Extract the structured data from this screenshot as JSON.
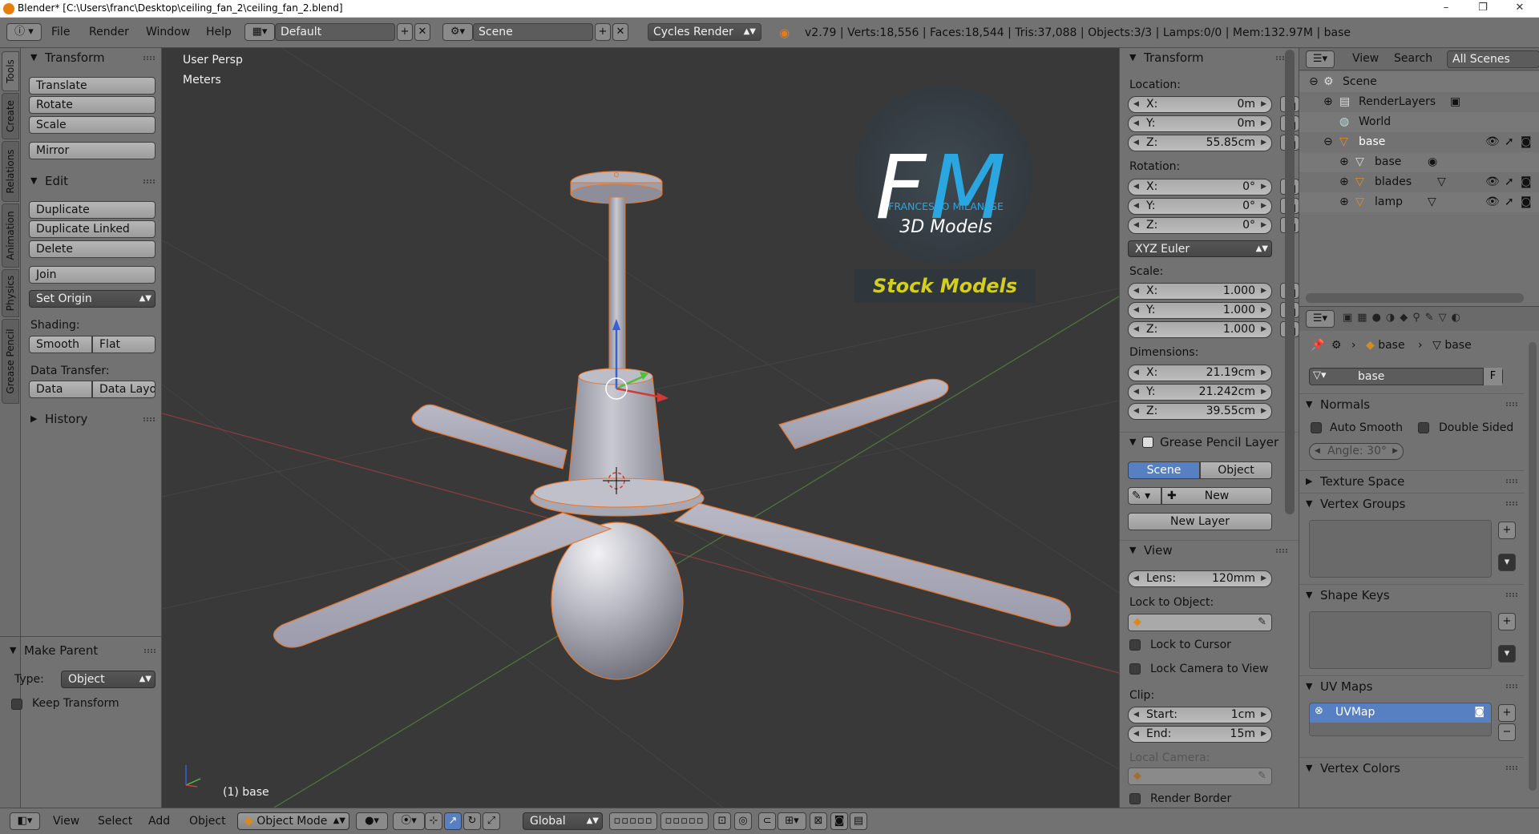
{
  "titlebar": {
    "title": "Blender* [C:\\Users\\franc\\Desktop\\ceiling_fan_2\\ceiling_fan_2.blend]",
    "minimize": "–",
    "maximize": "❐",
    "close": "✕"
  },
  "header": {
    "menus": [
      "File",
      "Render",
      "Window",
      "Help"
    ],
    "screen_layout": "Default",
    "scene": "Scene",
    "render_engine": "Cycles Render",
    "stats": "v2.79 | Verts:18,556 | Faces:18,544 | Tris:37,088 | Objects:3/3 | Lamps:0/0 | Mem:132.97M | base"
  },
  "tabs": [
    "Tools",
    "Create",
    "Relations",
    "Animation",
    "Physics",
    "Grease Pencil"
  ],
  "toolshelf": {
    "transform": {
      "title": "Transform",
      "buttons": [
        "Translate",
        "Rotate",
        "Scale",
        "Mirror"
      ]
    },
    "edit": {
      "title": "Edit",
      "buttons": [
        "Duplicate",
        "Duplicate Linked",
        "Delete",
        "Join"
      ],
      "set_origin": "Set Origin",
      "shading_label": "Shading:",
      "smooth": "Smooth",
      "flat": "Flat",
      "data_transfer_label": "Data Transfer:",
      "data": "Data",
      "data_layout": "Data Layo"
    },
    "history": "History",
    "make_parent": {
      "title": "Make Parent",
      "type_label": "Type:",
      "type_value": "Object",
      "keep_transform": "Keep Transform"
    }
  },
  "viewport": {
    "view_name": "User Persp",
    "units": "Meters",
    "selected": "(1) base",
    "watermark": {
      "letter_f": "F",
      "letter_m": "M",
      "line1": "FRANCESCO MILANESE",
      "line2": "3D Models",
      "banner": "Stock Models"
    }
  },
  "npanel": {
    "transform_title": "Transform",
    "location_label": "Location:",
    "location": [
      {
        "axis": "X:",
        "value": "0m"
      },
      {
        "axis": "Y:",
        "value": "0m"
      },
      {
        "axis": "Z:",
        "value": "55.85cm"
      }
    ],
    "rotation_label": "Rotation:",
    "rotation": [
      {
        "axis": "X:",
        "value": "0°"
      },
      {
        "axis": "Y:",
        "value": "0°"
      },
      {
        "axis": "Z:",
        "value": "0°"
      }
    ],
    "rotation_mode": "XYZ Euler",
    "scale_label": "Scale:",
    "scale": [
      {
        "axis": "X:",
        "value": "1.000"
      },
      {
        "axis": "Y:",
        "value": "1.000"
      },
      {
        "axis": "Z:",
        "value": "1.000"
      }
    ],
    "dimensions_label": "Dimensions:",
    "dimensions": [
      {
        "axis": "X:",
        "value": "21.19cm"
      },
      {
        "axis": "Y:",
        "value": "21.242cm"
      },
      {
        "axis": "Z:",
        "value": "39.55cm"
      }
    ],
    "grease_pencil_title": "Grease Pencil Layer",
    "gp_scene": "Scene",
    "gp_object": "Object",
    "gp_new": "New",
    "gp_new_layer": "New Layer",
    "view_title": "View",
    "lens_label": "Lens:",
    "lens": "120mm",
    "lock_to_object": "Lock to Object:",
    "lock_to_cursor": "Lock to Cursor",
    "lock_camera": "Lock Camera to View",
    "clip_label": "Clip:",
    "clip_start_label": "Start:",
    "clip_start": "1cm",
    "clip_end_label": "End:",
    "clip_end": "15m",
    "local_camera": "Local Camera:",
    "render_border": "Render Border"
  },
  "outliner": {
    "view": "View",
    "search": "Search",
    "all_scenes": "All Scenes",
    "rows": [
      "Scene",
      "RenderLayers",
      "World",
      "base",
      "base",
      "blades",
      "lamp"
    ]
  },
  "properties": {
    "breadcrumb_object": "base",
    "breadcrumb_data": "base",
    "datablock_name": "base",
    "fake_user": "F",
    "normals": "Normals",
    "auto_smooth": "Auto Smooth",
    "double_sided": "Double Sided",
    "angle_label": "Angle:",
    "angle_value": "30°",
    "texture_space": "Texture Space",
    "vertex_groups": "Vertex Groups",
    "shape_keys": "Shape Keys",
    "uv_maps": "UV Maps",
    "uv_map_name": "UVMap",
    "vertex_colors": "Vertex Colors"
  },
  "bottom": {
    "menus": [
      "View",
      "Select",
      "Add",
      "Object"
    ],
    "mode": "Object Mode",
    "orientation": "Global"
  },
  "colors": {
    "panel": "#727272",
    "viewport": "#393939",
    "selection_orange": "#e8762a",
    "active_blue": "#5680c2",
    "watermark_blue": "#2aa7e0",
    "watermark_yellow": "#d4cf1c"
  }
}
